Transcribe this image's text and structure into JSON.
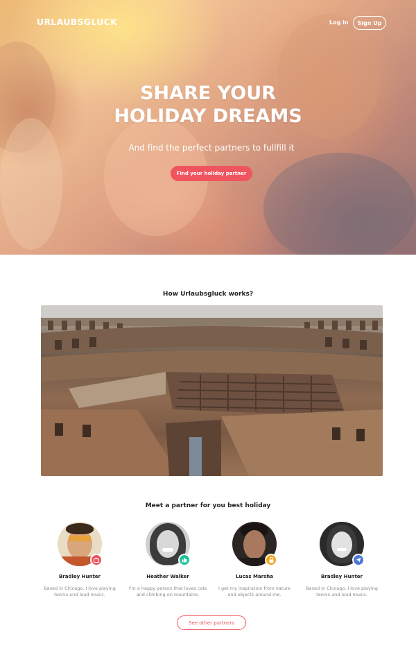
{
  "brand": {
    "name": "URLAUBSGLUCK"
  },
  "nav": {
    "login_label": "Log in",
    "signup_label": "Sign Up"
  },
  "hero": {
    "title_line1": "SHARE YOUR",
    "title_line2": "HOLIDAY DREAMS",
    "subtitle": "And find the perfect partners to fullfill it",
    "cta_label": "Find your holiday partner"
  },
  "how": {
    "title": "How Urlaubsgluck works?"
  },
  "partners": {
    "title": "Meet a partner for you best holiday",
    "items": [
      {
        "name": "Bradley Hunter",
        "bio": "Based in Chicago. I love playing tennis and loud music.",
        "badge_icon": "camera-icon",
        "badge_color": "#f0545f"
      },
      {
        "name": "Heather Walker",
        "bio": "I'm a happy person that loves cats and climbing on mountains.",
        "badge_icon": "thumbs-up-icon",
        "badge_color": "#1fc29a"
      },
      {
        "name": "Lucas Marsha",
        "bio": "I get my inspiration from nature and objects around me.",
        "badge_icon": "lock-icon",
        "badge_color": "#f5a623"
      },
      {
        "name": "Bradley Hunter",
        "bio": "Based in Chicago. I love playing tennis and loud music.",
        "badge_icon": "paper-plane-icon",
        "badge_color": "#4a79d6"
      }
    ],
    "more_label": "See other partners"
  },
  "colors": {
    "accent": "#f0545f",
    "text": "#222222",
    "muted": "#8a8a8a"
  }
}
